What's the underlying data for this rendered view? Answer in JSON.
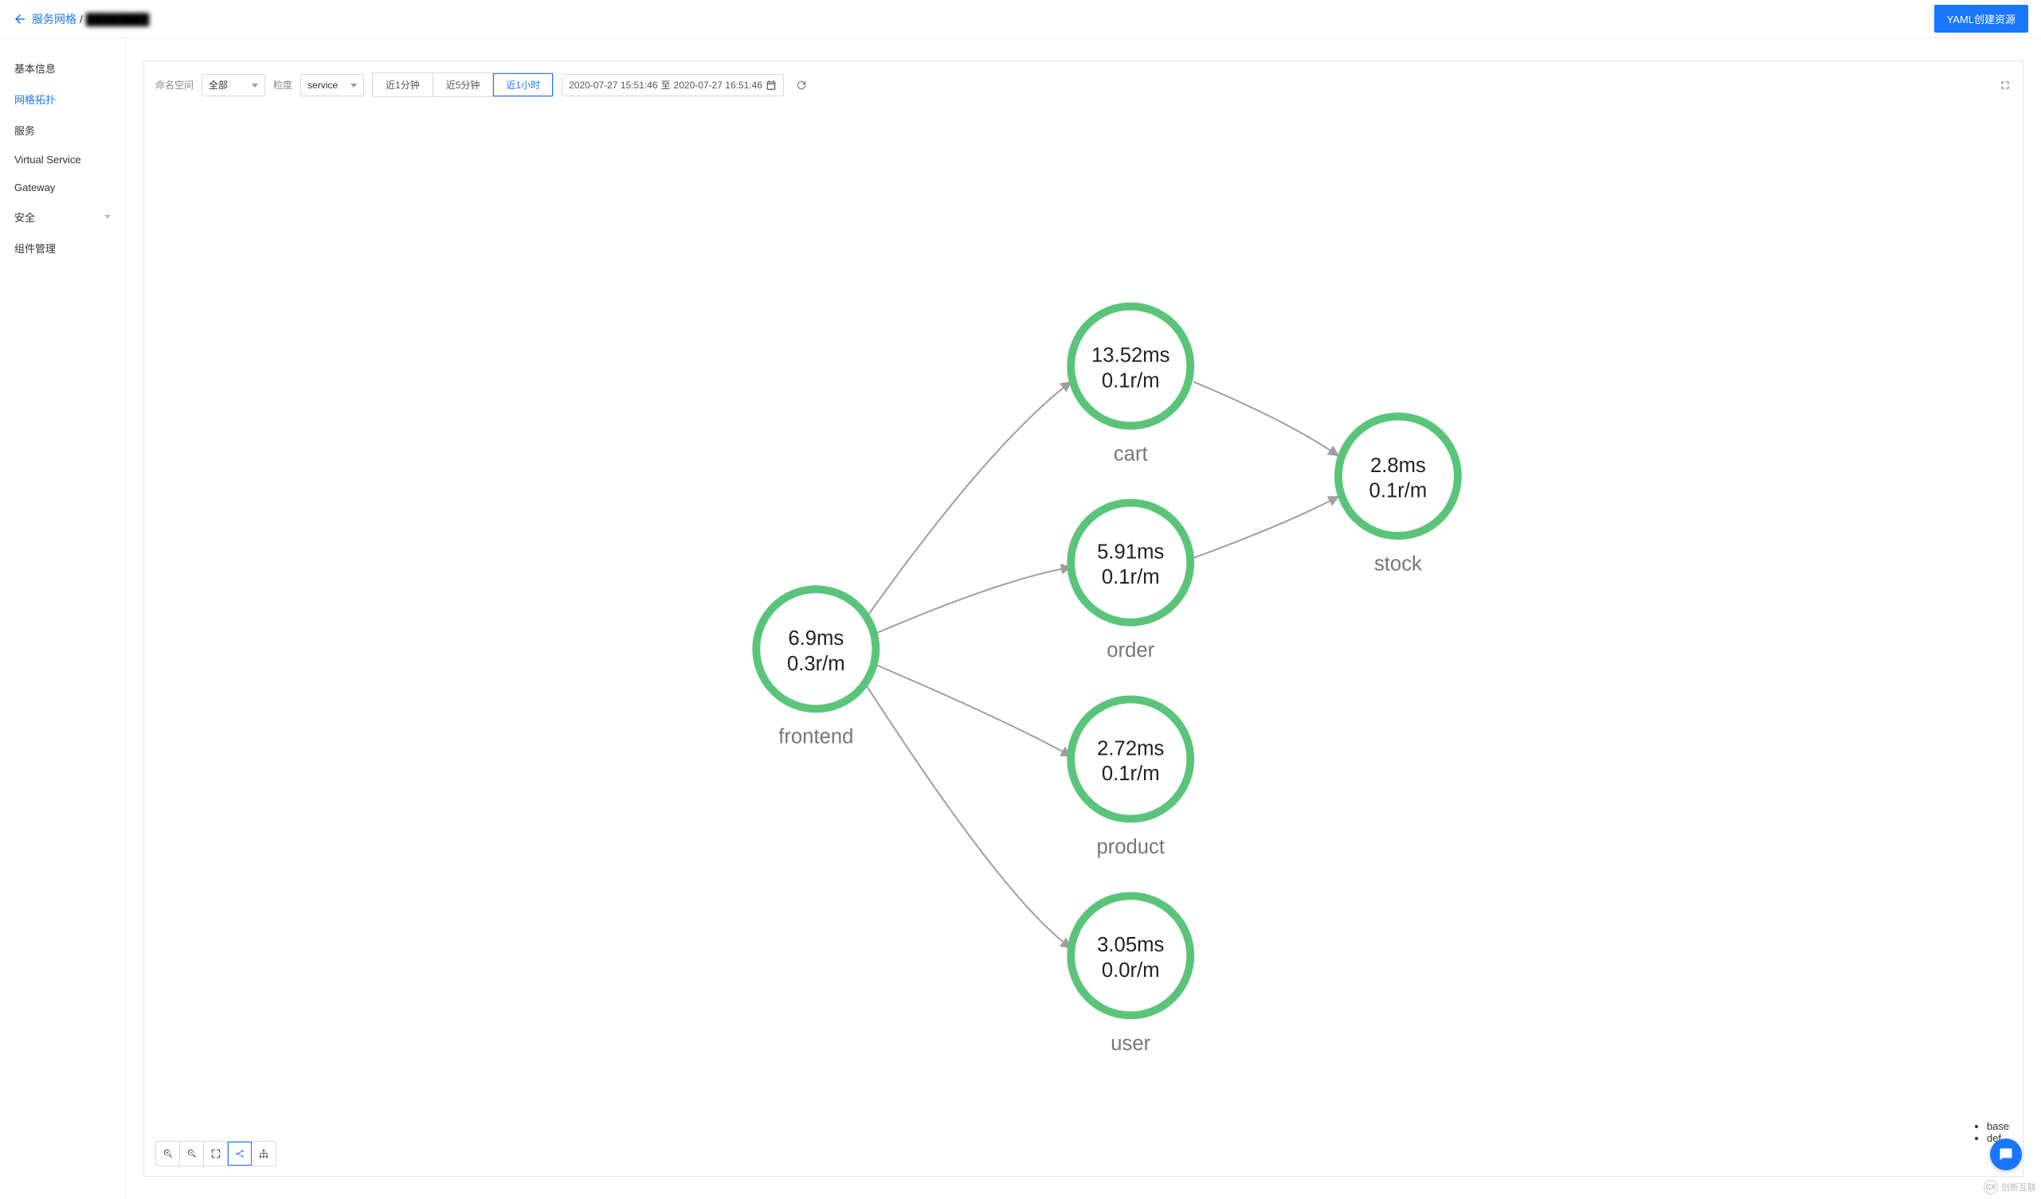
{
  "header": {
    "breadcrumb_root": "服务网格",
    "breadcrumb_current": "████████",
    "create_button": "YAML创建资源"
  },
  "sidebar": {
    "items": [
      {
        "label": "基本信息",
        "active": false
      },
      {
        "label": "网格拓扑",
        "active": true
      },
      {
        "label": "服务",
        "active": false
      },
      {
        "label": "Virtual Service",
        "active": false
      },
      {
        "label": "Gateway",
        "active": false
      },
      {
        "label": "安全",
        "active": false,
        "expandable": true
      },
      {
        "label": "组件管理",
        "active": false
      }
    ]
  },
  "toolbar": {
    "namespace_label": "命名空间",
    "namespace_value": "全部",
    "granularity_label": "粒度",
    "granularity_value": "service",
    "time_options": [
      "近1分钟",
      "近5分钟",
      "近1小时"
    ],
    "time_selected_index": 2,
    "date_from": "2020-07-27 15:51:46",
    "date_join": "至",
    "date_to": "2020-07-27 16:51:46"
  },
  "graph": {
    "nodes": {
      "frontend": {
        "latency": "6.9ms",
        "rate": "0.3r/m",
        "label": "frontend"
      },
      "cart": {
        "latency": "13.52ms",
        "rate": "0.1r/m",
        "label": "cart"
      },
      "order": {
        "latency": "5.91ms",
        "rate": "0.1r/m",
        "label": "order"
      },
      "product": {
        "latency": "2.72ms",
        "rate": "0.1r/m",
        "label": "product"
      },
      "user": {
        "latency": "3.05ms",
        "rate": "0.0r/m",
        "label": "user"
      },
      "stock": {
        "latency": "2.8ms",
        "rate": "0.1r/m",
        "label": "stock"
      }
    },
    "edges": [
      [
        "frontend",
        "cart"
      ],
      [
        "frontend",
        "order"
      ],
      [
        "frontend",
        "product"
      ],
      [
        "frontend",
        "user"
      ],
      [
        "cart",
        "stock"
      ],
      [
        "order",
        "stock"
      ]
    ]
  },
  "legend": {
    "items": [
      "base",
      "def…"
    ]
  },
  "watermark": "创新互联"
}
